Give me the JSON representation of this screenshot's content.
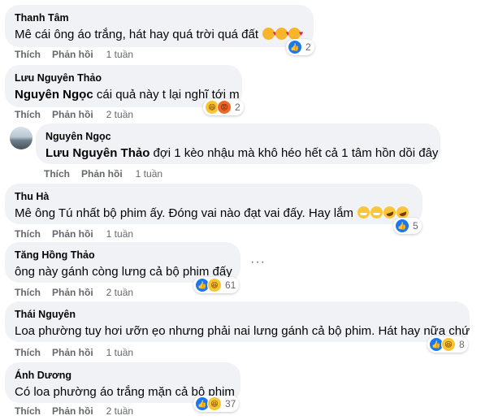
{
  "actions": {
    "like": "Thích",
    "reply": "Phản hồi"
  },
  "comments": [
    {
      "author": "Thanh Tâm",
      "mention": "",
      "text": "Mê cái ông áo trắng, hát hay quá trời quá đất",
      "time": "1 tuần",
      "reaction_count": "2",
      "reactions": [
        "like-icon"
      ],
      "inline_emojis": [
        "love-face",
        "love-face",
        "love-face"
      ]
    },
    {
      "author": "Lưu Nguyên Thảo",
      "mention": "Nguyên Ngọc",
      "text": " cái quả này t lại nghĩ tới m",
      "time": "2 tuần",
      "reaction_count": "2",
      "reactions": [
        "haha-icon",
        "angry-icon"
      ]
    },
    {
      "author": "Nguyên Ngọc",
      "mention": "Lưu Nguyên Thảo",
      "text": " đợi 1 kèo nhậu mà khô héo hết cả 1 tâm hồn dồi đây",
      "time": "1 tuần",
      "is_reply": true
    },
    {
      "author": "Thu Hà",
      "mention": "",
      "text": "Mê ông Tú nhất bộ phim ấy. Đóng vai nào đạt vai đấy. Hay lắm",
      "time": "1 tuần",
      "reaction_count": "5",
      "reactions": [
        "like-icon"
      ],
      "inline_emojis": [
        "grin-face",
        "grin-face",
        "laugh-face",
        "laugh-face"
      ]
    },
    {
      "author": "Tăng Hồng Thảo",
      "mention": "",
      "text": "ông này gánh còng lưng cả bộ phim đấy",
      "time": "2 tuần",
      "reaction_count": "61",
      "reactions": [
        "like-icon",
        "haha-icon"
      ]
    },
    {
      "author": "Thái Nguyên",
      "mention": "",
      "text": "Loa phường tuy hơi ưỡn ẹo nhưng phải nai lưng gánh cả bộ phim. Hát hay nữa chứ",
      "time": "1 tuần",
      "reaction_count": "8",
      "reactions": [
        "like-icon",
        "haha-icon"
      ]
    },
    {
      "author": "Ánh Dương",
      "mention": "",
      "text": "Có loa phường áo trắng mặn cả bộ phim",
      "time": "2 tuần",
      "reaction_count": "37",
      "reactions": [
        "like-icon",
        "haha-icon"
      ]
    }
  ]
}
